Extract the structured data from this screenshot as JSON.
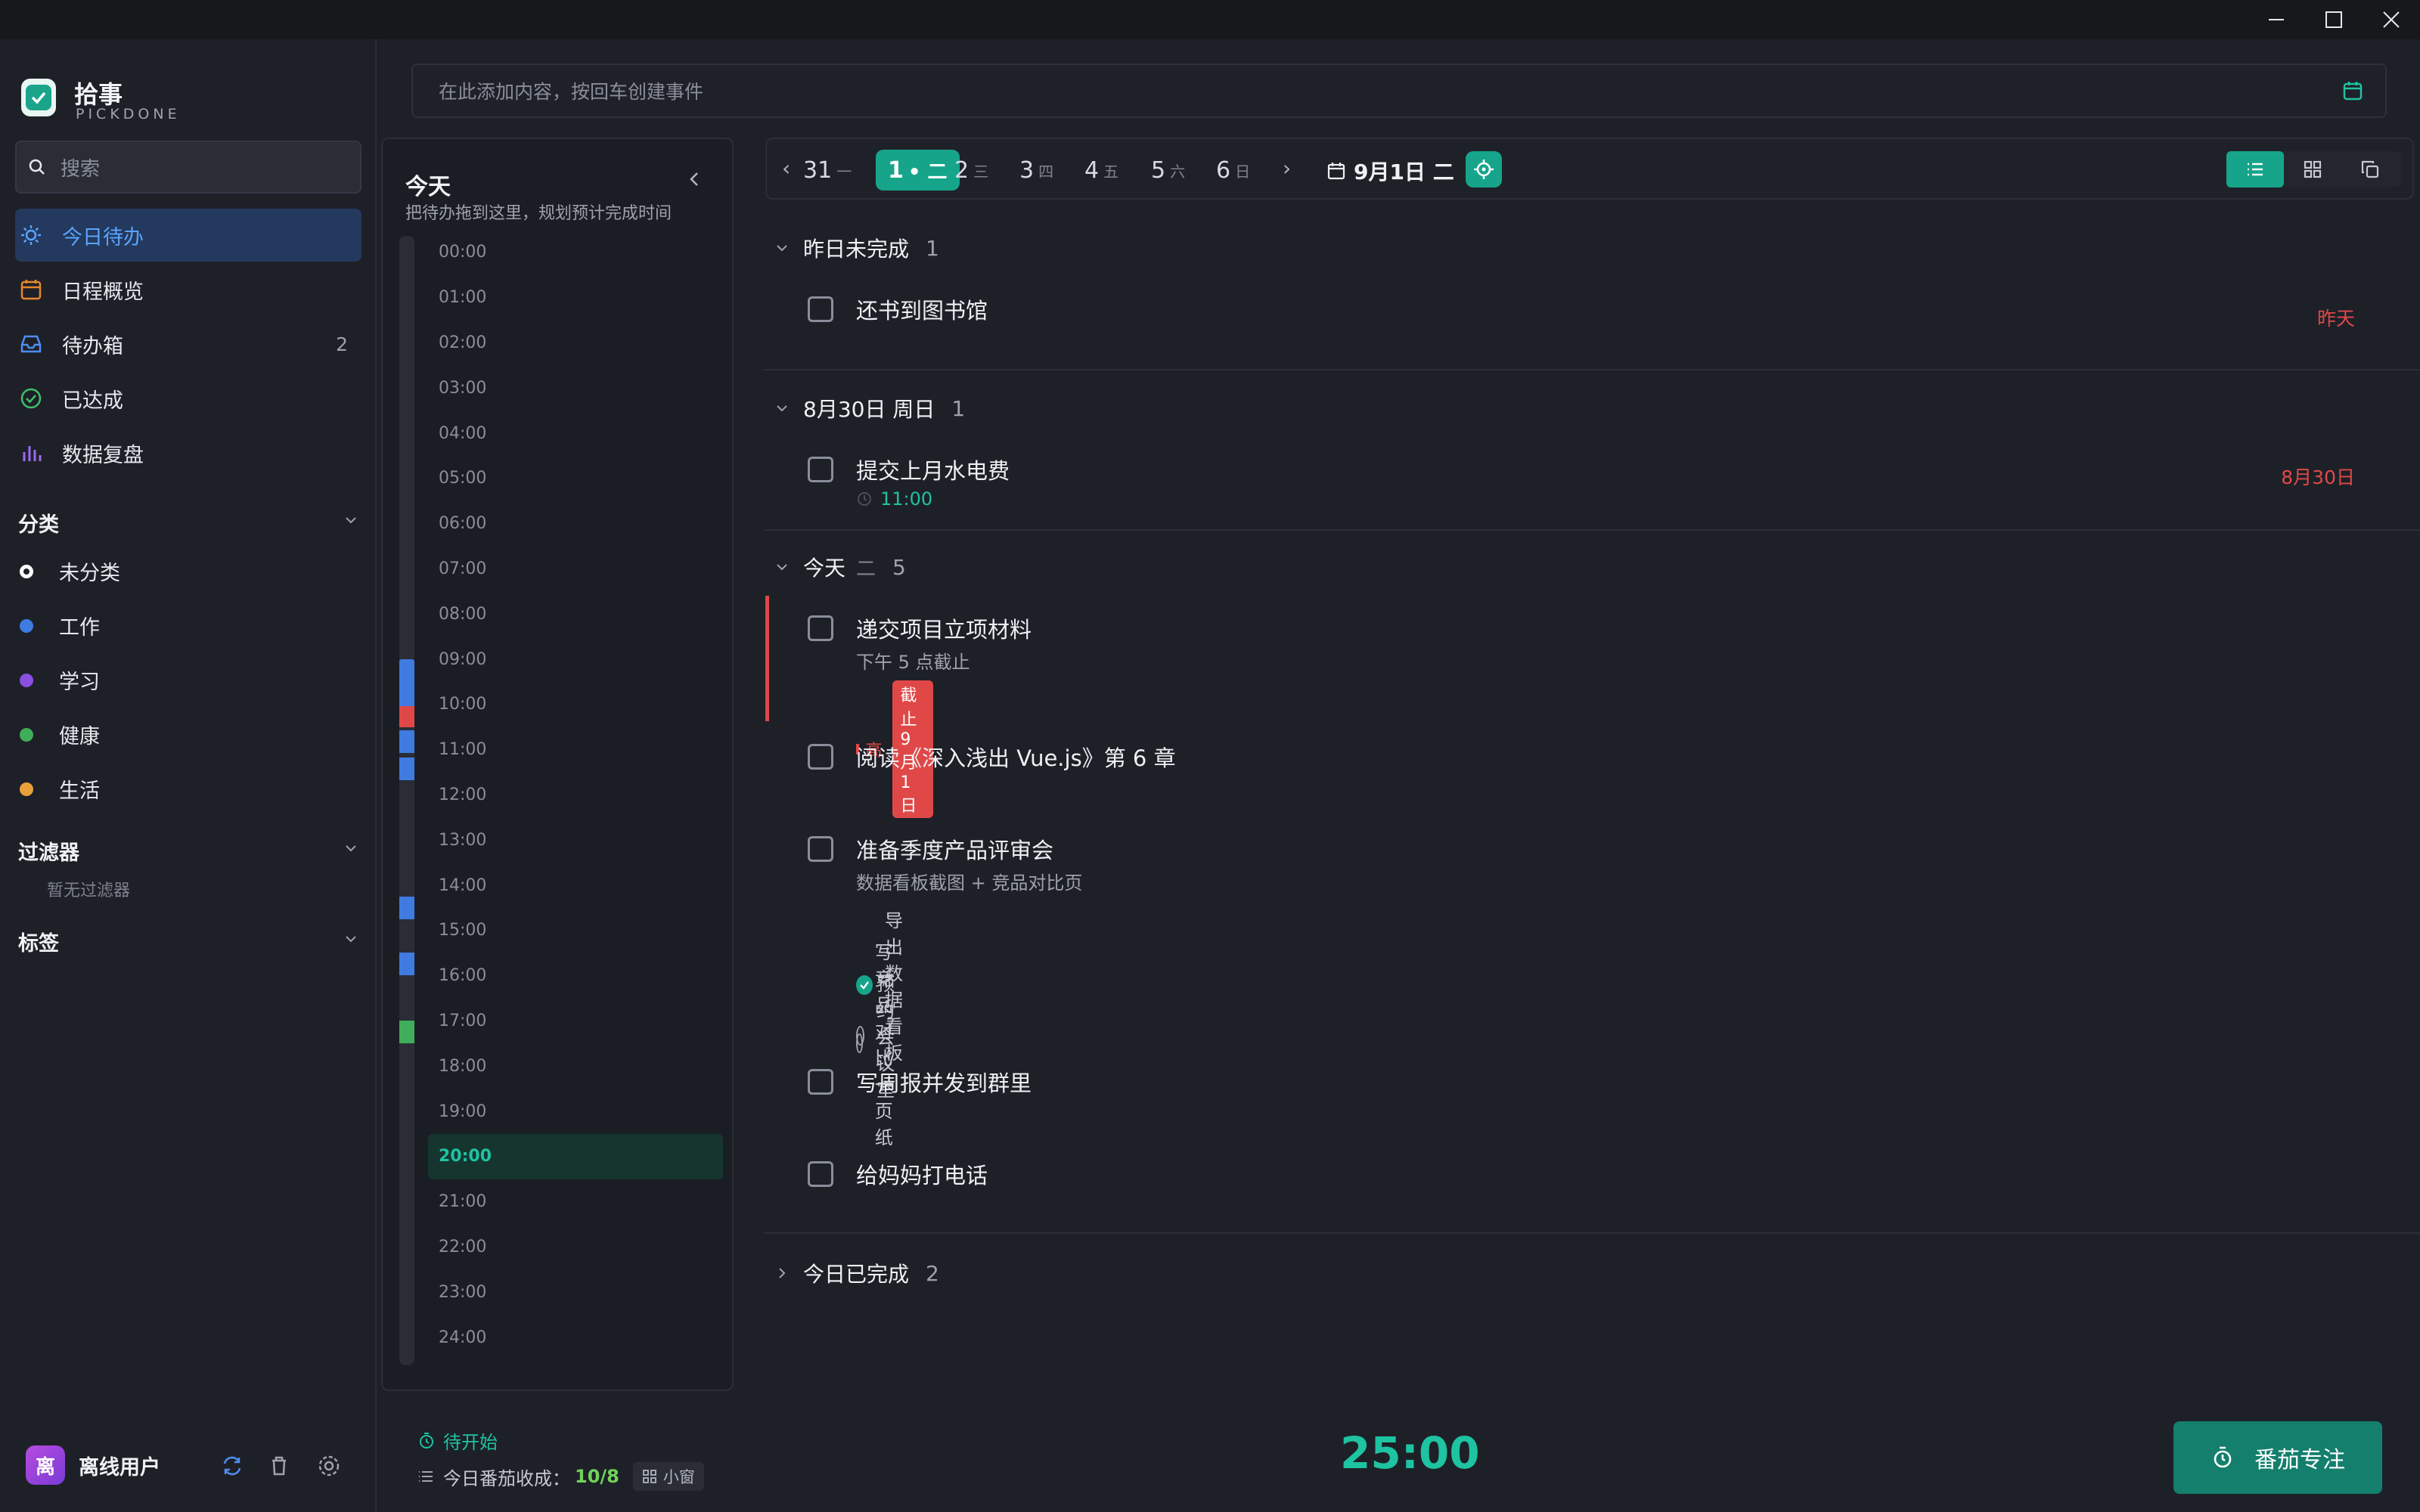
{
  "app": {
    "name": "拾事",
    "subtitle": "PICKDONE"
  },
  "colors": {
    "accent": "#16a58a",
    "danger": "#e04848",
    "active_nav": "#59a4ff"
  },
  "search": {
    "placeholder": "搜索"
  },
  "nav": [
    {
      "label": "今日待办",
      "icon": "sun-icon",
      "active": true
    },
    {
      "label": "日程概览",
      "icon": "calendar-icon"
    },
    {
      "label": "待办箱",
      "icon": "inbox-icon",
      "count": "2"
    },
    {
      "label": "已达成",
      "icon": "check-circle-icon"
    },
    {
      "label": "数据复盘",
      "icon": "bar-chart-icon"
    }
  ],
  "categories": {
    "title": "分类",
    "items": [
      {
        "label": "未分类",
        "color": "#ffffff"
      },
      {
        "label": "工作",
        "color": "#3f7be0"
      },
      {
        "label": "学习",
        "color": "#8a4fe0"
      },
      {
        "label": "健康",
        "color": "#3fae5a"
      },
      {
        "label": "生活",
        "color": "#e8a13a"
      }
    ]
  },
  "filters": {
    "title": "过滤器",
    "empty": "暂无过滤器"
  },
  "tags": {
    "title": "标签"
  },
  "user": {
    "avatar": "离",
    "name": "离线用户"
  },
  "timeline": {
    "title": "今天",
    "subtitle": "把待办拖到这里，规划预计完成时间",
    "hours": [
      "00:00",
      "01:00",
      "02:00",
      "03:00",
      "04:00",
      "05:00",
      "06:00",
      "07:00",
      "08:00",
      "09:00",
      "10:00",
      "11:00",
      "12:00",
      "13:00",
      "14:00",
      "15:00",
      "16:00",
      "17:00",
      "18:00",
      "19:00",
      "20:00",
      "21:00",
      "22:00",
      "23:00",
      "24:00"
    ],
    "current_hour": "20:00"
  },
  "quickadd": {
    "placeholder": "在此添加内容，按回车创建事件"
  },
  "datebar": {
    "prev": "‹",
    "next": "›",
    "days": [
      {
        "num": "31",
        "wd": "一"
      },
      {
        "num": "1",
        "wd": "• 二",
        "active": true
      },
      {
        "num": "2",
        "wd": "三"
      },
      {
        "num": "3",
        "wd": "四"
      },
      {
        "num": "4",
        "wd": "五"
      },
      {
        "num": "5",
        "wd": "六"
      },
      {
        "num": "6",
        "wd": "日"
      }
    ],
    "today": "9月1日 二"
  },
  "groups": {
    "yesterday": {
      "title": "昨日未完成",
      "count": "1"
    },
    "aug30": {
      "title": "8月30日 周日",
      "count": "1"
    },
    "today": {
      "title": "今天",
      "weekday": "二",
      "count": "5"
    },
    "done": {
      "title": "今日已完成",
      "count": "2"
    }
  },
  "tasks": {
    "t1": {
      "title": "还书到图书馆",
      "due": "昨天"
    },
    "t2": {
      "title": "提交上月水电费",
      "time": "11:00",
      "due": "8月30日"
    },
    "t3": {
      "title": "递交项目立项材料",
      "note": "下午 5 点截止",
      "priority": "高",
      "deadline": "截止 9月1日"
    },
    "t4": {
      "title": "阅读《深入浅出 Vue.js》第 6 章"
    },
    "t5": {
      "title": "准备季度产品评审会",
      "note": "数据看板截图 + 竞品对比页",
      "subtasks": [
        {
          "label": "导出数据看板",
          "done": true
        },
        {
          "label": "写竞品对比一页纸",
          "done": false
        },
        {
          "label": "预约会议室",
          "done": false
        }
      ]
    },
    "t6": {
      "title": "写周报并发到群里"
    },
    "t7": {
      "title": "给妈妈打电话"
    }
  },
  "pomodoro": {
    "status": "待开始",
    "count_label": "今日番茄收成：",
    "count": "10/8",
    "mini": "小窗",
    "timer": "25:00",
    "button": "番茄专注"
  }
}
